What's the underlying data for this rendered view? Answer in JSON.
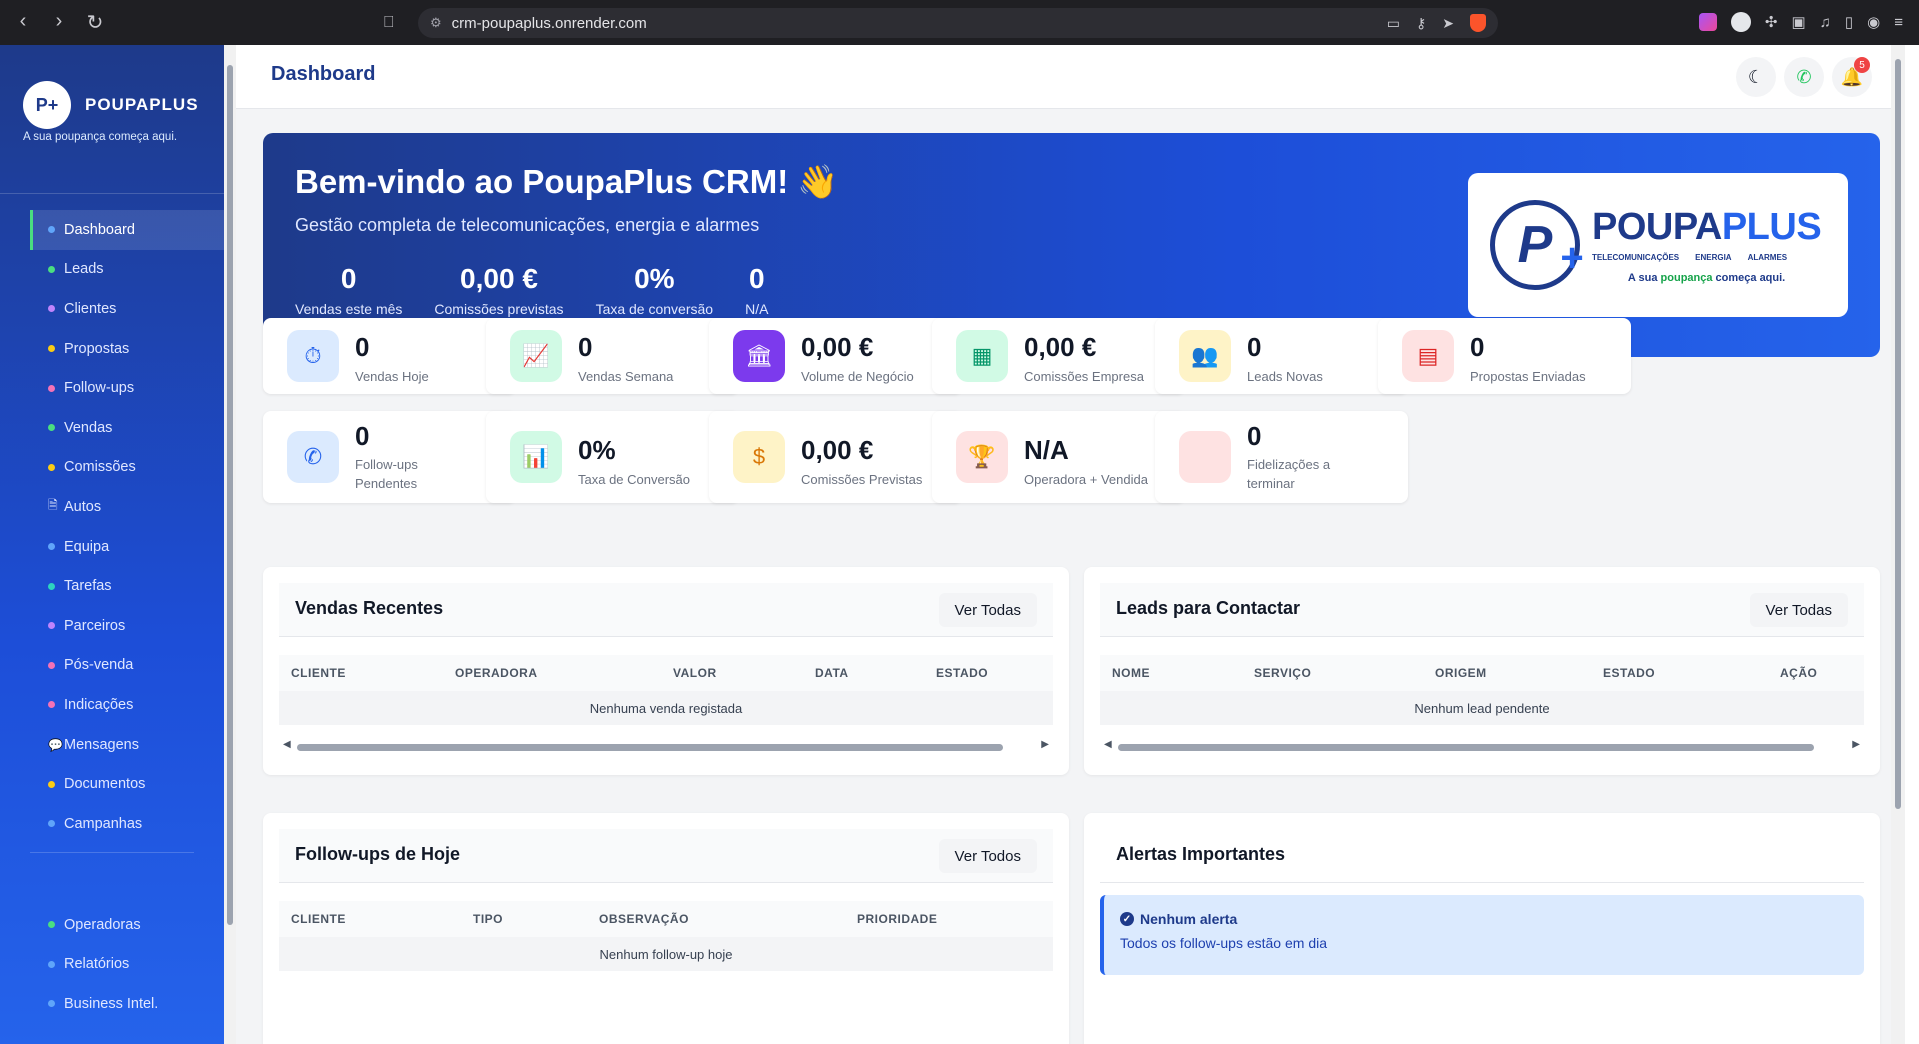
{
  "browser": {
    "url": "crm-poupaplus.onrender.com"
  },
  "sidebar": {
    "brand_logo": "P+",
    "brand_name": "POUPAPLUS",
    "tagline": "A sua poupança começa aqui.",
    "items": [
      {
        "label": "Dashboard",
        "color": "#60a5fa",
        "active": true
      },
      {
        "label": "Leads",
        "color": "#4ade80"
      },
      {
        "label": "Clientes",
        "color": "#c084fc"
      },
      {
        "label": "Propostas",
        "color": "#facc15"
      },
      {
        "label": "Follow-ups",
        "color": "#f472b6"
      },
      {
        "label": "Vendas",
        "color": "#4ade80"
      },
      {
        "label": "Comissões",
        "color": "#facc15"
      },
      {
        "label": "Autos",
        "icon": "document-icon"
      },
      {
        "label": "Equipa",
        "color": "#60a5fa"
      },
      {
        "label": "Tarefas",
        "color": "#2dd4bf"
      },
      {
        "label": "Parceiros",
        "color": "#c084fc"
      },
      {
        "label": "Pós-venda",
        "color": "#f472b6"
      },
      {
        "label": "Indicações",
        "color": "#f472b6"
      },
      {
        "label": "Mensagens",
        "icon": "chat-icon"
      },
      {
        "label": "Documentos",
        "color": "#facc15"
      },
      {
        "label": "Campanhas",
        "color": "#60a5fa"
      }
    ],
    "items2": [
      {
        "label": "Operadoras",
        "color": "#4ade80"
      },
      {
        "label": "Relatórios",
        "color": "#60a5fa"
      },
      {
        "label": "Business Intel.",
        "color": "#60a5fa"
      }
    ]
  },
  "header": {
    "title": "Dashboard",
    "notification_count": "5"
  },
  "hero": {
    "title": "Bem-vindo ao PoupaPlus CRM! 👋",
    "subtitle": "Gestão completa de telecomunicações, energia e alarmes",
    "stats": [
      {
        "value": "0",
        "label": "Vendas este mês"
      },
      {
        "value": "0,00 €",
        "label": "Comissões previstas"
      },
      {
        "value": "0%",
        "label": "Taxa de conversão"
      },
      {
        "value": "0",
        "label": "N/A"
      }
    ],
    "logo": {
      "mark": "P",
      "name_a": "POUPA",
      "name_b": "PLUS",
      "cat1": "TELECOMUNICAÇÕES",
      "cat2": "ENERGIA",
      "cat3": "ALARMES",
      "tag_a": "A sua ",
      "tag_b": "poupança",
      "tag_c": " começa aqui."
    }
  },
  "stats": [
    {
      "value": "0",
      "label": "Vendas Hoje",
      "icon": "money-clock-icon",
      "bg": "#dbeafe",
      "fg": "#2563eb",
      "glyph": "⏱"
    },
    {
      "value": "0",
      "label": "Vendas Semana",
      "icon": "line-chart-icon",
      "bg": "#d1fae5",
      "fg": "#059669",
      "glyph": "📈"
    },
    {
      "value": "0,00 €",
      "label": "Volume de Negócio",
      "icon": "bank-icon",
      "bg": "#7c3aed",
      "fg": "#ffffff",
      "glyph": "🏛"
    },
    {
      "value": "0,00 €",
      "label": "Comissões Empresa",
      "icon": "calculator-icon",
      "bg": "#d1fae5",
      "fg": "#059669",
      "glyph": "▦"
    },
    {
      "value": "0",
      "label": "Leads Novas",
      "icon": "users-icon",
      "bg": "#fef3c7",
      "fg": "#d97706",
      "glyph": "👥"
    },
    {
      "value": "0",
      "label": "Propostas Enviadas",
      "icon": "document-icon",
      "bg": "#fee2e2",
      "fg": "#dc2626",
      "glyph": "▤"
    },
    {
      "value": "0",
      "label": "Follow-ups Pendentes",
      "icon": "phone-icon",
      "bg": "#dbeafe",
      "fg": "#2563eb",
      "glyph": "✆"
    },
    {
      "value": "0%",
      "label": "Taxa de Conversão",
      "icon": "bar-chart-icon",
      "bg": "#d1fae5",
      "fg": "#059669",
      "glyph": "📊"
    },
    {
      "value": "0,00 €",
      "label": "Comissões Previstas",
      "icon": "dollar-icon",
      "bg": "#fef3c7",
      "fg": "#d97706",
      "glyph": "$"
    },
    {
      "value": "N/A",
      "label": "Operadora + Vendida",
      "icon": "trophy-icon",
      "bg": "#fee2e2",
      "fg": "#dc2626",
      "glyph": "🏆"
    },
    {
      "value": "0",
      "label": "Fidelizações a terminar",
      "icon": "blank-icon",
      "bg": "#fee2e2",
      "fg": "#fee2e2",
      "glyph": ""
    }
  ],
  "vendas": {
    "title": "Vendas Recentes",
    "button": "Ver Todas",
    "columns": [
      "CLIENTE",
      "OPERADORA",
      "VALOR",
      "DATA",
      "ESTADO"
    ],
    "empty": "Nenhuma venda registada"
  },
  "leads": {
    "title": "Leads para Contactar",
    "button": "Ver Todas",
    "columns": [
      "NOME",
      "SERVIÇO",
      "ORIGEM",
      "ESTADO",
      "AÇÃO"
    ],
    "empty": "Nenhum lead pendente"
  },
  "followups": {
    "title": "Follow-ups de Hoje",
    "button": "Ver Todos",
    "columns": [
      "CLIENTE",
      "TIPO",
      "OBSERVAÇÃO",
      "PRIORIDADE"
    ],
    "empty": "Nenhum follow-up hoje"
  },
  "alertas": {
    "title": "Alertas Importantes",
    "alert_title": "Nenhum alerta",
    "alert_text": "Todos os follow-ups estão em dia"
  }
}
